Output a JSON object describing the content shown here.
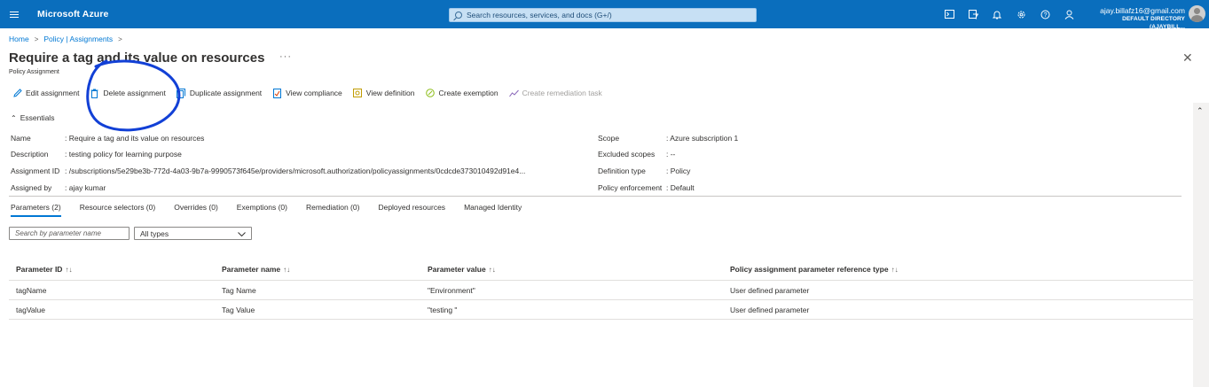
{
  "topbar": {
    "brand": "Microsoft Azure",
    "search_placeholder": "Search resources, services, and docs (G+/)",
    "user_email": "ajay.billafz16@gmail.com",
    "user_directory": "DEFAULT DIRECTORY (AJAYBILL...",
    "icons": [
      "cloud-shell-icon",
      "directory-filter-icon",
      "notifications-icon",
      "settings-icon",
      "help-icon",
      "feedback-icon"
    ]
  },
  "breadcrumb": {
    "items": [
      "Home",
      "Policy | Assignments"
    ]
  },
  "page": {
    "title": "Require a tag and its value on resources",
    "subtitle": "Policy Assignment",
    "more": "···"
  },
  "toolbar": {
    "edit": "Edit assignment",
    "delete": "Delete assignment",
    "duplicate": "Duplicate assignment",
    "compliance": "View compliance",
    "definition": "View definition",
    "exemption": "Create exemption",
    "remediation": "Create remediation task"
  },
  "essentials": {
    "toggle_label": "Essentials",
    "left": [
      {
        "key": "Name",
        "value": ": Require a tag and its value on resources"
      },
      {
        "key": "Description",
        "value": ": testing policy for learning purpose"
      },
      {
        "key": "Assignment ID",
        "value": ": /subscriptions/5e29be3b-772d-4a03-9b7a-9990573f645e/providers/microsoft.authorization/policyassignments/0cdcde373010492d91e4..."
      },
      {
        "key": "Assigned by",
        "value": ": ajay kumar"
      }
    ],
    "right": [
      {
        "key": "Scope",
        "value": ": Azure subscription 1"
      },
      {
        "key": "Excluded scopes",
        "value": ": --"
      },
      {
        "key": "Definition type",
        "value": ": Policy"
      },
      {
        "key": "Policy enforcement",
        "value": ": Default"
      }
    ]
  },
  "tabs": [
    "Parameters (2)",
    "Resource selectors (0)",
    "Overrides (0)",
    "Exemptions (0)",
    "Remediation (0)",
    "Deployed resources",
    "Managed Identity"
  ],
  "filters": {
    "search_placeholder": "Search by parameter name",
    "type_value": "All types"
  },
  "table": {
    "headers": [
      "Parameter ID",
      "Parameter name",
      "Parameter value",
      "Policy assignment parameter reference type"
    ],
    "rows": [
      [
        "tagName",
        "Tag Name",
        "\"Environment\"",
        "User defined parameter"
      ],
      [
        "tagValue",
        "Tag Value",
        "\"testing \"",
        "User defined parameter"
      ]
    ]
  },
  "colors": {
    "topbar": "#0a6ebd",
    "link": "#0078d4",
    "annotation": "#1240d6"
  }
}
